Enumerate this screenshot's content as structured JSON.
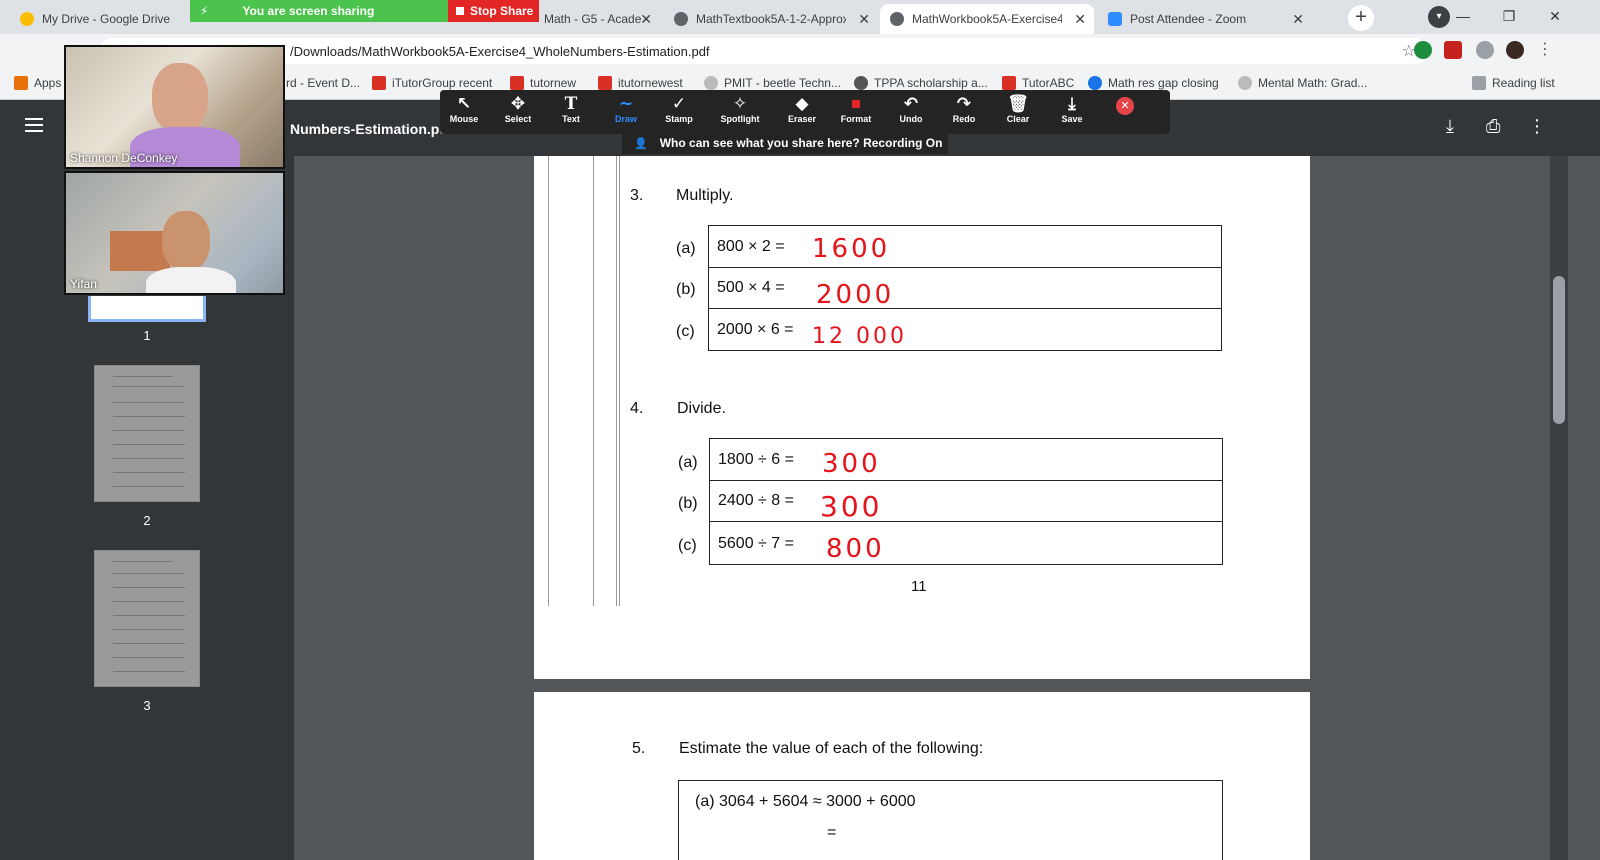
{
  "tabs": [
    {
      "label": "My Drive - Google Drive",
      "color": "#1a73e8"
    },
    {
      "label": "Math - G5 - Acade",
      "color": "#34a853"
    },
    {
      "label": "MathTextbook5A-1-2-Approx",
      "color": "#5f6368"
    },
    {
      "label": "MathWorkbook5A-Exercise4_",
      "color": "#5f6368"
    },
    {
      "label": "Post Attendee - Zoom",
      "color": "#2d8cff"
    }
  ],
  "sharing": {
    "text": "You are screen sharing",
    "stop": "Stop Share"
  },
  "address": {
    "url": "/Downloads/MathWorkbook5A-Exercise4_WholeNumbers-Estimation.pdf"
  },
  "bookmarks": [
    {
      "label": "Apps",
      "color": "#e8710a"
    },
    {
      "label": "rd - Event D...",
      "color": "#888888"
    },
    {
      "label": "iTutorGroup recent",
      "color": "#d93025"
    },
    {
      "label": "tutornew",
      "color": "#d93025"
    },
    {
      "label": "itutornewest",
      "color": "#d93025"
    },
    {
      "label": "PMIT - beetle Techn...",
      "color": "#888888"
    },
    {
      "label": "TPPA scholarship a...",
      "color": "#555555"
    },
    {
      "label": "TutorABC",
      "color": "#d93025"
    },
    {
      "label": "Math res gap closing",
      "color": "#1a73e8"
    },
    {
      "label": "Mental Math: Grad...",
      "color": "#888888"
    },
    {
      "label": "Reading list",
      "color": "#5f6368"
    }
  ],
  "pdf": {
    "title": "Numbers-Estimation.pd",
    "page_numbers": [
      "1",
      "2",
      "3"
    ]
  },
  "annotation_tools": [
    {
      "label": "Mouse",
      "icon": "↖"
    },
    {
      "label": "Select",
      "icon": "✥"
    },
    {
      "label": "Text",
      "icon": "T"
    },
    {
      "label": "Draw",
      "icon": "∼"
    },
    {
      "label": "Stamp",
      "icon": "✓"
    },
    {
      "label": "Spotlight",
      "icon": "✧"
    },
    {
      "label": "Eraser",
      "icon": "◆"
    },
    {
      "label": "Format",
      "icon": "■"
    },
    {
      "label": "Undo",
      "icon": "↶"
    },
    {
      "label": "Redo",
      "icon": "↷"
    },
    {
      "label": "Clear",
      "icon": "🗑"
    },
    {
      "label": "Save",
      "icon": "⤓"
    }
  ],
  "recording_notice": "Who can see what you share here? Recording On",
  "participants": [
    {
      "name": "Shannon DeConkey"
    },
    {
      "name": "Yifan"
    }
  ],
  "worksheet": {
    "q3": {
      "number": "3.",
      "title": "Multiply.",
      "rows": [
        {
          "label": "(a)",
          "expr": "800 × 2 =",
          "answer": "1600"
        },
        {
          "label": "(b)",
          "expr": "500 × 4 =",
          "answer": "2000"
        },
        {
          "label": "(c)",
          "expr": "2000 × 6 =",
          "answer": "12 000"
        }
      ]
    },
    "q4": {
      "number": "4.",
      "title": "Divide.",
      "rows": [
        {
          "label": "(a)",
          "expr": "1800 ÷ 6 =",
          "answer": "300"
        },
        {
          "label": "(b)",
          "expr": "2400 ÷ 8 =",
          "answer": "300"
        },
        {
          "label": "(c)",
          "expr": "5600 ÷ 7 =",
          "answer": "800"
        }
      ]
    },
    "page_number": "11",
    "q5": {
      "number": "5.",
      "title": "Estimate the value of each of the following:",
      "row_a": "(a)  3064 + 5604 ≈ 3000 + 6000",
      "row_a_eq": "="
    }
  },
  "colors": {
    "accent": "#2d8cff",
    "sharing": "#4cc34c",
    "stop": "#e22626",
    "ink": "#e3141a"
  }
}
